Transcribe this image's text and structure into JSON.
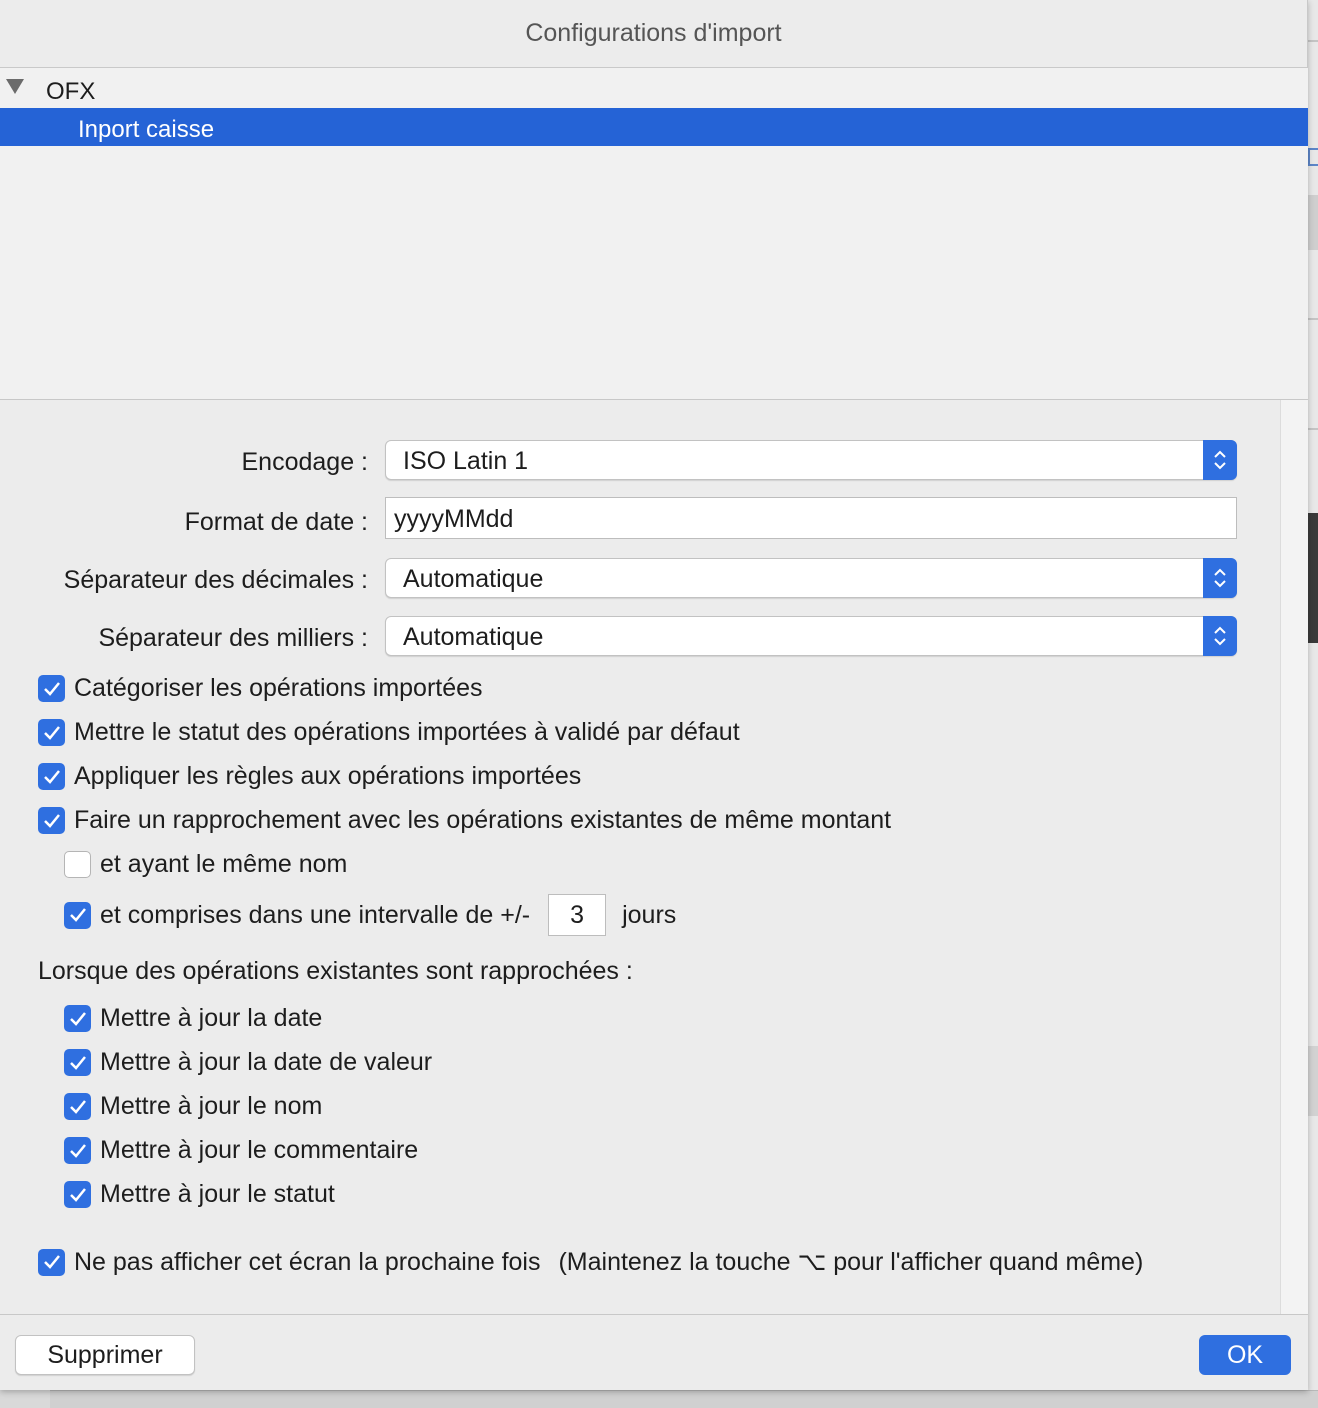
{
  "window": {
    "title": "Configurations d'import"
  },
  "tree": {
    "group_label": "OFX",
    "selected_item": "Inport caisse"
  },
  "form": {
    "encoding": {
      "label": "Encodage :",
      "value": "ISO Latin 1"
    },
    "date_format": {
      "label": "Format de date :",
      "value": "yyyyMMdd"
    },
    "decimal_separator": {
      "label": "Séparateur des décimales :",
      "value": "Automatique"
    },
    "thousands_separator": {
      "label": "Séparateur des milliers :",
      "value": "Automatique"
    },
    "options": [
      {
        "label": "Catégoriser les opérations importées",
        "checked": true
      },
      {
        "label": "Mettre le statut des opérations importées à validé par défaut",
        "checked": true
      },
      {
        "label": "Appliquer les règles aux opérations importées",
        "checked": true
      },
      {
        "label": "Faire un rapprochement avec les opérations existantes de même montant",
        "checked": true
      }
    ],
    "same_name": {
      "label": "et ayant le même nom",
      "checked": false
    },
    "interval": {
      "label": "et comprises dans une intervalle de +/-",
      "checked": true,
      "value": "3",
      "unit": "jours"
    },
    "on_match_label": "Lorsque des opérations existantes sont rapprochées :",
    "on_match": [
      {
        "label": "Mettre à jour la date",
        "checked": true
      },
      {
        "label": "Mettre à jour la date de valeur",
        "checked": true
      },
      {
        "label": "Mettre à jour le nom",
        "checked": true
      },
      {
        "label": "Mettre à jour le commentaire",
        "checked": true
      },
      {
        "label": "Mettre à jour le statut",
        "checked": true
      }
    ],
    "dont_show": {
      "label": "Ne pas afficher cet écran la prochaine fois",
      "hint": "(Maintenez la touche ⌥ pour l'afficher quand même)",
      "checked": true
    }
  },
  "footer": {
    "delete_label": "Supprimer",
    "ok_label": "OK"
  },
  "colors": {
    "accent": "#2f6fe0",
    "selection": "#2563d6",
    "window_bg": "#ececec"
  }
}
